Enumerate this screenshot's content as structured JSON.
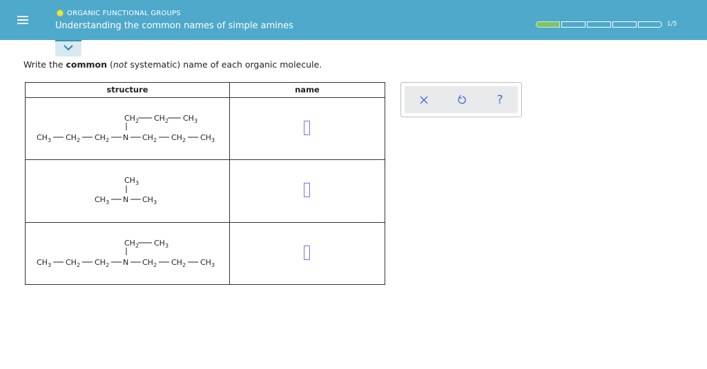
{
  "header": {
    "topic": "ORGANIC FUNCTIONAL GROUPS",
    "lesson_title": "Understanding the common names of simple amines",
    "progress": {
      "current": 1,
      "total": 5,
      "label": "1/5"
    },
    "colors": {
      "bar": "#4fa9cb",
      "topic_dot": "#e7e548",
      "progress_fill": "#7fc36a"
    }
  },
  "instructions": {
    "before": "Write the ",
    "bold": "common",
    "middle1": " (",
    "italic": "not",
    "after": " systematic) name of each organic molecule."
  },
  "table": {
    "headers": {
      "structure": "structure",
      "name": "name"
    },
    "rows": [
      {
        "branch": [
          "CH2",
          "CH2",
          "CH3"
        ],
        "main": [
          "CH3",
          "CH2",
          "CH2",
          "N",
          "CH2",
          "CH2",
          "CH3"
        ],
        "answer": ""
      },
      {
        "branch": [
          "CH3"
        ],
        "main": [
          "CH3",
          "N",
          "CH3"
        ],
        "answer": ""
      },
      {
        "branch": [
          "CH2",
          "CH3"
        ],
        "main": [
          "CH3",
          "CH2",
          "CH2",
          "N",
          "CH2",
          "CH2",
          "CH3"
        ],
        "answer": ""
      }
    ]
  },
  "actions": {
    "icons": [
      "close-icon",
      "undo-icon",
      "help-icon"
    ],
    "help_glyph": "?",
    "accent": "#4b6bd6"
  }
}
